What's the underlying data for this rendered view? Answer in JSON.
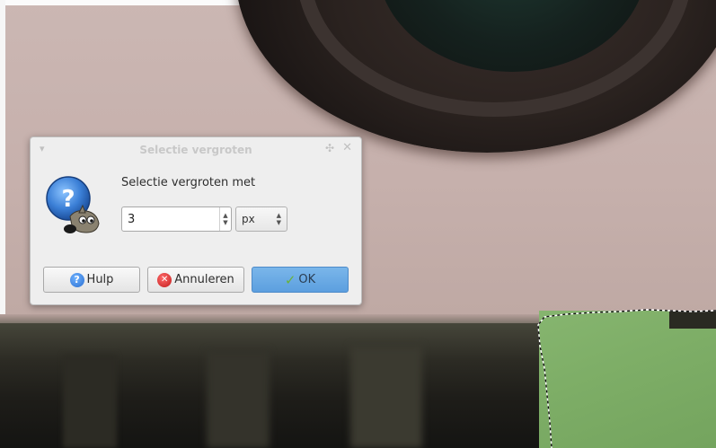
{
  "dialog": {
    "title": "Selectie vergroten",
    "prompt": "Selectie vergroten met",
    "grow_amount": "3",
    "unit": "px",
    "buttons": {
      "help": "Hulp",
      "cancel": "Annuleren",
      "ok": "OK"
    },
    "icons": {
      "titlebar_menu": "▾",
      "titlebar_stick": "✣",
      "titlebar_close": "✕",
      "dialog_icon": "question-wilber-icon",
      "spin_up": "▲",
      "spin_down": "▼",
      "help": "?",
      "cancel": "✕",
      "ok": "✓"
    }
  },
  "colors": {
    "dialog_bg": "#eeeeee",
    "ok_button": "#5c9fdf",
    "help_icon": "#2b6fd1",
    "cancel_icon": "#c21d1d",
    "ok_check": "#6ab23a",
    "selection_area": "#7eae67"
  }
}
